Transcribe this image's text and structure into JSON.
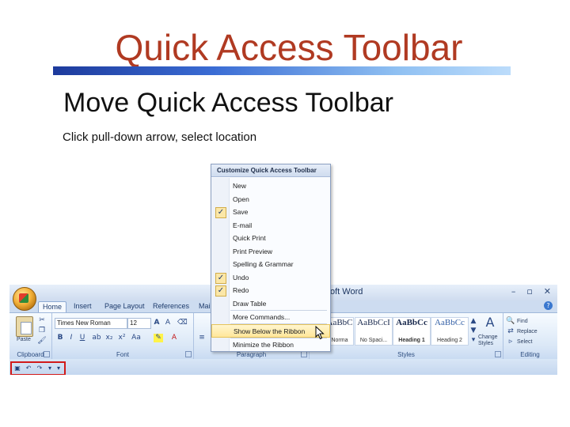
{
  "slide": {
    "title": "Quick Access Toolbar",
    "subtitle": "Move Quick Access Toolbar",
    "instruction": "Click pull-down arrow, select location"
  },
  "word": {
    "app_title": "oft Word",
    "window_buttons": [
      "–",
      "▫",
      "✕"
    ],
    "help": "?",
    "tabs": [
      "Home",
      "Insert",
      "Page Layout",
      "References",
      "Mail"
    ],
    "groups": {
      "clipboard": "Clipboard",
      "font": "Font",
      "paragraph": "Paragraph",
      "styles": "Styles",
      "editing": "Editing"
    },
    "paste_label": "Paste",
    "font_name": "Times New Roman",
    "font_size": "12",
    "styles": [
      {
        "preview": "AaBbC",
        "name": "Norma"
      },
      {
        "preview": "AaBbCcI",
        "name": "No Spaci..."
      },
      {
        "preview": "AaBbCc",
        "name": "Heading 1"
      },
      {
        "preview": "AaBbCc",
        "name": "Heading 2"
      }
    ],
    "change_styles": "Change Styles",
    "editing": {
      "find": "Find",
      "replace": "Replace",
      "select": "Select"
    }
  },
  "menu": {
    "header": "Customize Quick Access Toolbar",
    "items": [
      {
        "label": "New",
        "checked": false
      },
      {
        "label": "Open",
        "checked": false
      },
      {
        "label": "Save",
        "checked": true
      },
      {
        "label": "E-mail",
        "checked": false
      },
      {
        "label": "Quick Print",
        "checked": false
      },
      {
        "label": "Print Preview",
        "checked": false
      },
      {
        "label": "Spelling & Grammar",
        "checked": false
      },
      {
        "label": "Undo",
        "checked": true
      },
      {
        "label": "Redo",
        "checked": true
      },
      {
        "label": "Draw Table",
        "checked": false
      },
      {
        "label": "More Commands...",
        "checked": false
      },
      {
        "label": "Show Below the Ribbon",
        "checked": false,
        "highlighted": true
      },
      {
        "label": "Minimize the Ribbon",
        "checked": false
      }
    ]
  },
  "colors": {
    "title": "#b03a22",
    "menu_highlight": "#ffe79a",
    "qat_outline": "#d11a1a"
  }
}
